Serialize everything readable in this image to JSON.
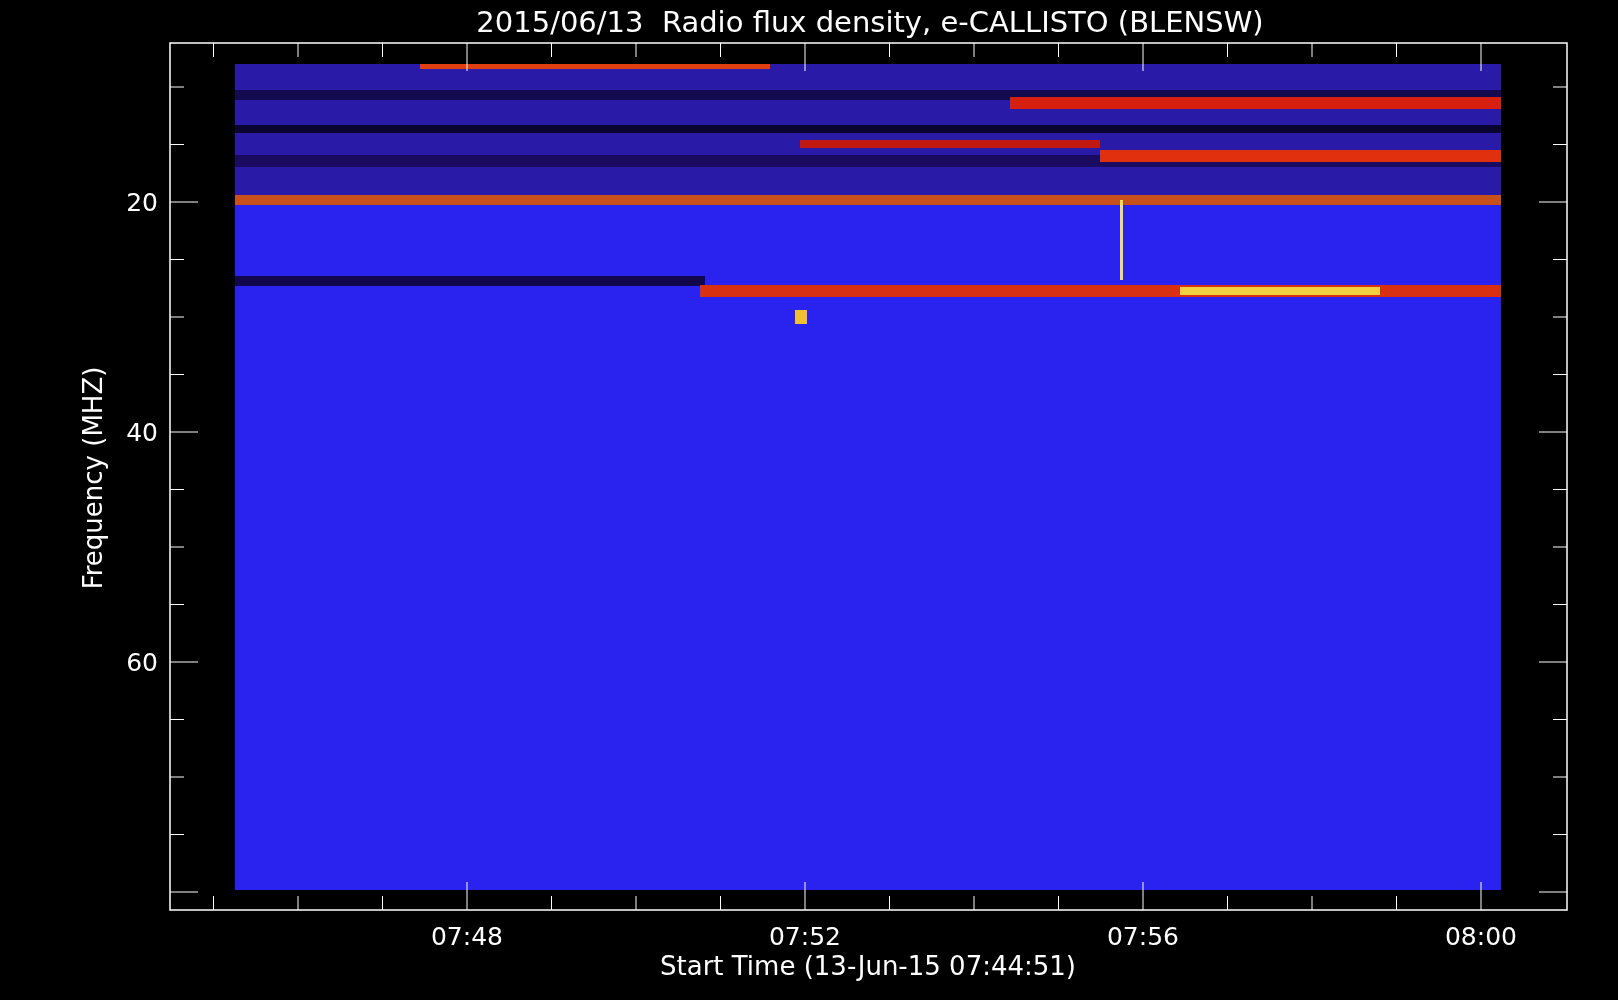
{
  "title": "2015/06/13  Radio flux density, e-CALLISTO (BLENSW)",
  "y_axis": {
    "label": "Frequency (MHZ)",
    "ticks": [
      "20",
      "40",
      "60"
    ]
  },
  "x_axis": {
    "label": "Start Time (13-Jun-15 07:44:51)",
    "ticks": [
      "07:48",
      "07:52",
      "07:56",
      "08:00"
    ]
  }
}
